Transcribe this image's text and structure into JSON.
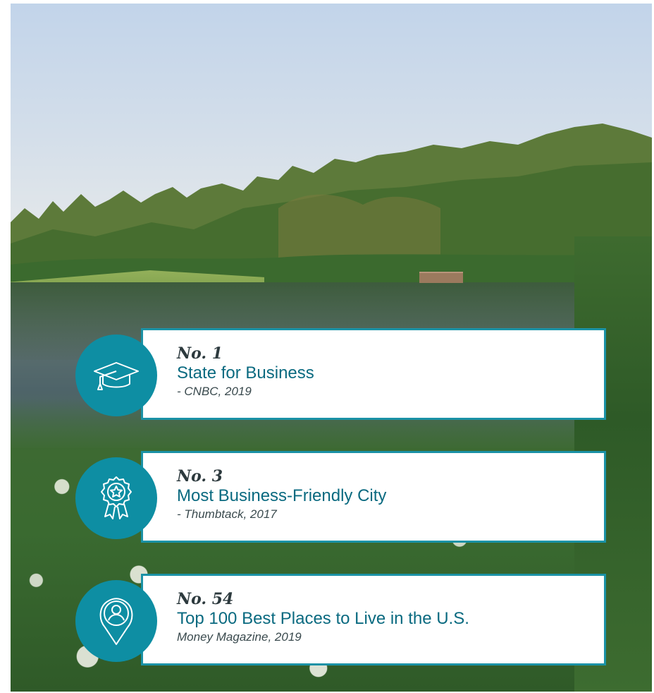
{
  "colors": {
    "accent": "#0e8ea3",
    "card_border": "#1b92a6",
    "title_text": "#0a6a80",
    "rank_text": "#2d3a3e",
    "source_text": "#3a4a4e"
  },
  "background": {
    "icon": "nature-lake-photo"
  },
  "rankings": [
    {
      "rank": "No. 1",
      "title": "State for Business",
      "source": "- CNBC, 2019",
      "icon": "graduation-cap-icon"
    },
    {
      "rank": "No. 3",
      "title": "Most Business-Friendly City",
      "source": "- Thumbtack, 2017",
      "icon": "award-ribbon-icon"
    },
    {
      "rank": "No. 54",
      "title": "Top 100 Best Places to Live in the U.S.",
      "source": "Money Magazine, 2019",
      "icon": "location-person-icon"
    }
  ]
}
